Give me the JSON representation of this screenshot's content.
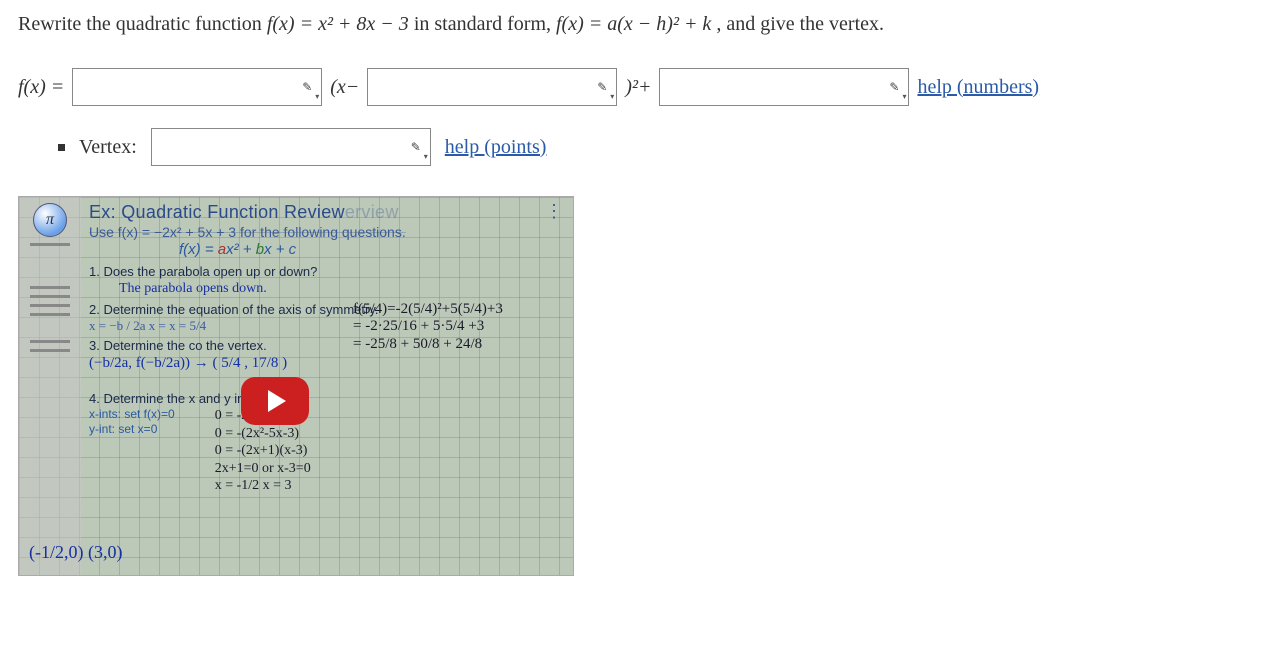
{
  "question": {
    "prefix": "Rewrite the quadratic function ",
    "fx_def": "f(x) = x² + 8x − 3",
    "mid": " in standard form, ",
    "std_form": "f(x) = a(x − h)² + k",
    "suffix": ", and give the vertex."
  },
  "row": {
    "fx_eq": "f(x) =",
    "a_value": "",
    "open_paren": "(x−",
    "h_value": "",
    "close_paren": ")²+",
    "k_value": "",
    "help_numbers": "help (numbers)"
  },
  "vertex": {
    "label": "Vertex:",
    "value": "",
    "help_points": "help (points)"
  },
  "video": {
    "pi": "π",
    "title_main": "Ex: Quadratic Function Review",
    "title_faded": "erview",
    "sub": "Use f(x) = −2x² + 5x + 3 for the following questions.",
    "formula": "f(x) = ax² + bx + c",
    "step1": "1. Does the parabola open up or down?",
    "hand1": "The parabola opens down.",
    "step2": "2. Determine the equation of the axis of symmetry.",
    "axis_formula": "x = −b / 2a      x =           x = 5/4",
    "step3": "3. Determine the co                 the vertex.",
    "line3a": "(−b/2a, f(−b/2a))  →  ( 5/4 , 17/8 )",
    "step4": "4. Determine the x and y intercepts.",
    "xints": "x-ints: set f(x)=0",
    "yints": "y-int: set x=0",
    "eq1": "0 = -2x² +5x+ 3",
    "eq2": "0 = -(2x²-5x-3)",
    "eq3": "0 = -(2x+1)(x-3)",
    "eq4": "2x+1=0  or  x-3=0",
    "eq5": "x = -1/2       x = 3",
    "side1": "f(5/4)=-2(5/4)²+5(5/4)+3",
    "side2": "= -2·25/16 + 5·5/4 +3",
    "side3": "= -25/8 + 50/8 + 24/8",
    "bottom_coord": "(-1/2,0) (3,0)"
  }
}
